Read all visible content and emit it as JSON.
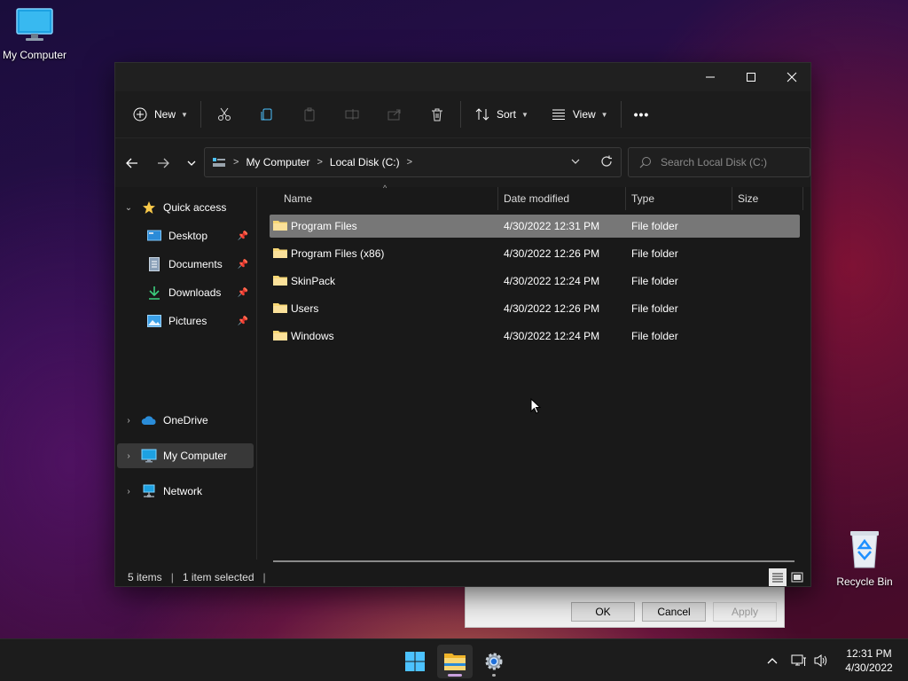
{
  "desktop": {
    "my_computer_label": "My Computer",
    "recycle_bin_label": "Recycle Bin"
  },
  "dialog": {
    "ok_label": "OK",
    "cancel_label": "Cancel",
    "apply_label": "Apply"
  },
  "window": {
    "caption": {
      "minimize": "—",
      "maximize": "□",
      "close": "✕"
    },
    "toolbar": {
      "new_label": "New",
      "sort_label": "Sort",
      "view_label": "View",
      "more_label": "•••"
    },
    "address": {
      "crumbs": [
        "My Computer",
        "Local Disk (C:)"
      ],
      "search_placeholder": "Search Local Disk (C:)"
    },
    "sidebar": {
      "items": [
        {
          "label": "Quick access",
          "icon": "star-icon"
        },
        {
          "label": "Desktop",
          "icon": "desktop-icon",
          "pinned": true
        },
        {
          "label": "Documents",
          "icon": "documents-icon",
          "pinned": true
        },
        {
          "label": "Downloads",
          "icon": "download-icon",
          "pinned": true
        },
        {
          "label": "Pictures",
          "icon": "pictures-icon",
          "pinned": true
        },
        {
          "label": "OneDrive",
          "icon": "cloud-icon"
        },
        {
          "label": "My Computer",
          "icon": "computer-icon",
          "selected": true
        },
        {
          "label": "Network",
          "icon": "network-icon"
        }
      ]
    },
    "columns": {
      "name": "Name",
      "date": "Date modified",
      "type": "Type",
      "size": "Size"
    },
    "files": [
      {
        "name": "Program Files",
        "date": "4/30/2022 12:31 PM",
        "type": "File folder",
        "selected": true
      },
      {
        "name": "Program Files (x86)",
        "date": "4/30/2022 12:26 PM",
        "type": "File folder"
      },
      {
        "name": "SkinPack",
        "date": "4/30/2022 12:24 PM",
        "type": "File folder"
      },
      {
        "name": "Users",
        "date": "4/30/2022 12:26 PM",
        "type": "File folder"
      },
      {
        "name": "Windows",
        "date": "4/30/2022 12:24 PM",
        "type": "File folder"
      }
    ],
    "status": {
      "items": "5 items",
      "selected": "1 item selected",
      "sep": "|"
    }
  },
  "taskbar": {
    "time": "12:31 PM",
    "date": "4/30/2022",
    "apps": [
      "start-icon",
      "file-explorer-icon",
      "settings-icon"
    ]
  },
  "colors": {
    "accent": "#4cc2ff",
    "folder": "#f8d775",
    "selection": "#777777"
  }
}
